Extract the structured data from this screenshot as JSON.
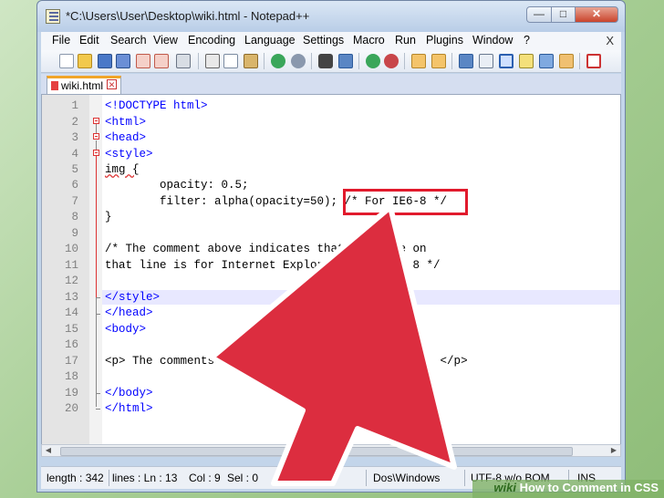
{
  "window": {
    "title": "*C:\\Users\\User\\Desktop\\wiki.html - Notepad++"
  },
  "caption_buttons": {
    "minimize": "—",
    "maximize": "□",
    "close": "✕"
  },
  "menu": [
    "File",
    "Edit",
    "Search",
    "View",
    "Encoding",
    "Language",
    "Settings",
    "Macro",
    "Run",
    "Plugins",
    "Window",
    "?"
  ],
  "menu_close": "X",
  "tab": {
    "label": "wiki.html",
    "close": "✕"
  },
  "editor": {
    "lines": [
      {
        "n": "1",
        "text": "<!DOCTYPE html>",
        "kind": "tag"
      },
      {
        "n": "2",
        "text": "<html>",
        "kind": "tag"
      },
      {
        "n": "3",
        "text": "<head>",
        "kind": "tag"
      },
      {
        "n": "4",
        "text": "<style>",
        "kind": "tag"
      },
      {
        "n": "5",
        "text": "img {",
        "kind": "plain"
      },
      {
        "n": "6",
        "text": "        opacity: 0.5;",
        "kind": "plain"
      },
      {
        "n": "7",
        "text": "        filter: alpha(opacity=50); /* For IE6-8 */",
        "kind": "plain"
      },
      {
        "n": "8",
        "text": "}",
        "kind": "plain"
      },
      {
        "n": "9",
        "text": "",
        "kind": "plain"
      },
      {
        "n": "10",
        "text": "/* The comment above indicates that the code on",
        "kind": "plain"
      },
      {
        "n": "11",
        "text": "that line is for Internet Explorer 6, 7, and 8 */",
        "kind": "plain"
      },
      {
        "n": "12",
        "text": "",
        "kind": "plain"
      },
      {
        "n": "13",
        "text": "</style>",
        "kind": "tag"
      },
      {
        "n": "14",
        "text": "</head>",
        "kind": "tag"
      },
      {
        "n": "15",
        "text": "<body>",
        "kind": "tag"
      },
      {
        "n": "16",
        "text": "",
        "kind": "plain"
      },
      {
        "n": "17",
        "text": "<p> The comments won't be displayed on the page. </p>",
        "kind": "tag"
      },
      {
        "n": "18",
        "text": "",
        "kind": "plain"
      },
      {
        "n": "19",
        "text": "</body>",
        "kind": "tag"
      },
      {
        "n": "20",
        "text": "</html>",
        "kind": "tag"
      }
    ]
  },
  "status": {
    "length": "length : 342",
    "lines": "lines : Ln : 13",
    "col": "Col : 9",
    "sel": "Sel : 0",
    "eol": "Dos\\Windows",
    "encoding": "UTF-8 w/o BOM",
    "mode": "INS"
  },
  "watermark": {
    "brand": "wiki",
    "text": "How to Comment in CSS"
  },
  "colors": {
    "highlight": "#e11a2c",
    "arrow": "#dc2d3f",
    "accent_tab": "#f0a52a"
  }
}
